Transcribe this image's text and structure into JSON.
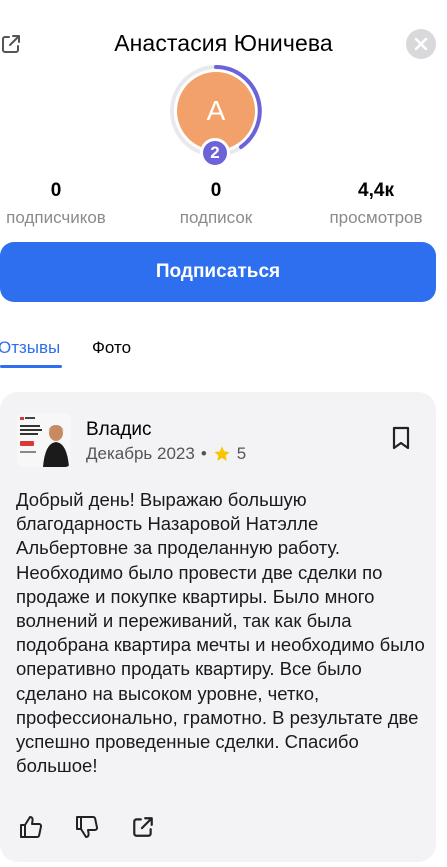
{
  "header": {
    "title": "Анастасия Юничева",
    "share_icon": "external-link-icon",
    "close_icon": "close-icon"
  },
  "profile": {
    "avatar_letter": "А",
    "avatar_color": "#f2a16a",
    "level": "2",
    "level_color": "#6c63d8"
  },
  "stats": [
    {
      "value": "0",
      "label": "подписчиков"
    },
    {
      "value": "0",
      "label": "подписок"
    },
    {
      "value": "4,4к",
      "label": "просмотров"
    }
  ],
  "subscribe_label": "Подписаться",
  "accent_color": "#2e6ff0",
  "tabs": [
    {
      "label": "Отзывы",
      "active": true
    },
    {
      "label": "Фото",
      "active": false
    }
  ],
  "review": {
    "author": "Владис",
    "date": "Декабрь 2023",
    "rating": "5",
    "text": "Добрый день! Выражаю большую благодарность Назаровой Натэлле Альбертовне за проделанную работу. Необходимо было провести две сделки по продаже и покупке квартиры. Было много волнений и переживаний, так как была подобрана квартира мечты и необходимо было оперативно продать квартиру. Все было сделано на высоком уровне, четко, профессионально, грамотно. В результате две успешно проведенные сделки. Спасибо большое!",
    "actions": [
      "like-icon",
      "dislike-icon",
      "share-icon"
    ]
  }
}
